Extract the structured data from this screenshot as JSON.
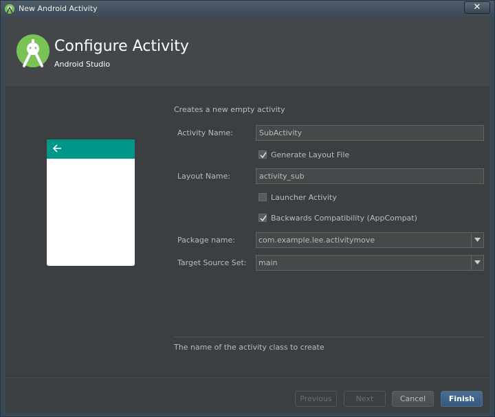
{
  "window": {
    "title": "New Android Activity",
    "close_label": "✕"
  },
  "header": {
    "title": "Configure Activity",
    "subtitle": "Android Studio"
  },
  "form": {
    "description": "Creates a new empty activity",
    "activity_name_label": "Activity Name:",
    "activity_name_value": "SubActivity",
    "generate_layout_label": "Generate Layout File",
    "generate_layout_checked": true,
    "layout_name_label": "Layout Name:",
    "layout_name_value": "activity_sub",
    "launcher_activity_label": "Launcher Activity",
    "launcher_activity_checked": false,
    "backwards_compat_label": "Backwards Compatibility (AppCompat)",
    "backwards_compat_checked": true,
    "package_name_label": "Package name:",
    "package_name_value": "com.example.lee.activitymove",
    "target_source_set_label": "Target Source Set:",
    "target_source_set_value": "main"
  },
  "help": {
    "text": "The name of the activity class to create"
  },
  "buttons": {
    "previous": "Previous",
    "next": "Next",
    "cancel": "Cancel",
    "finish": "Finish"
  },
  "colors": {
    "accent": "#009688",
    "logo": "#78c257",
    "primary_button": "#365880"
  }
}
